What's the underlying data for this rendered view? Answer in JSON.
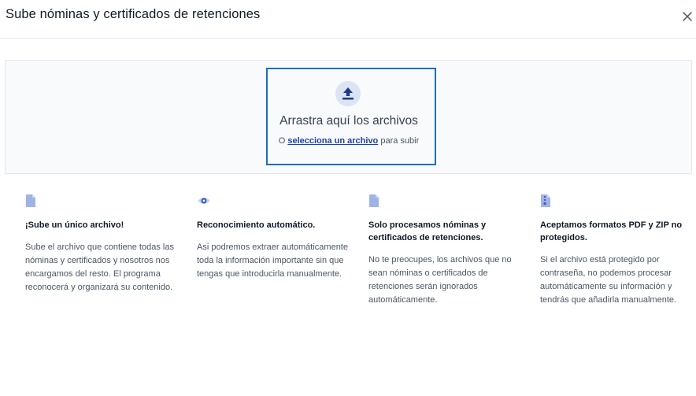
{
  "modal": {
    "title": "Sube nóminas y certificados de retenciones",
    "close_icon": "close-icon"
  },
  "dropzone": {
    "icon": "upload-icon",
    "title": "Arrastra aquí los archivos",
    "prefix": "O ",
    "link": "selecciona un archivo",
    "suffix": " para subir"
  },
  "colors": {
    "accent": "#1d6fb8",
    "link": "#1e40af",
    "icon": "#9fb3e6"
  },
  "features": [
    {
      "icon": "file-icon",
      "title": "¡Sube un único archivo!",
      "description": "Sube el archivo que contiene todas las nóminas y certificados y nosotros nos encargamos del resto. El programa reconocerá y organizará su contenido."
    },
    {
      "icon": "eye-icon",
      "title": "Reconocimiento automático.",
      "description": "Asi podremos extraer automáticamente toda la información importante sin que tengas que introducirla manualmente."
    },
    {
      "icon": "file-icon",
      "title": "Solo procesamos nóminas y certificados de retenciones.",
      "description": "No te preocupes, los archivos que no sean nóminas o certificados de retenciones serán ignorados automáticamente."
    },
    {
      "icon": "zip-file-icon",
      "title": "Aceptamos formatos PDF y ZIP no protegidos.",
      "description": "Si el archivo está protegido por contraseña, no podemos procesar automáticamente su información y tendrás que añadirla manualmente."
    }
  ]
}
